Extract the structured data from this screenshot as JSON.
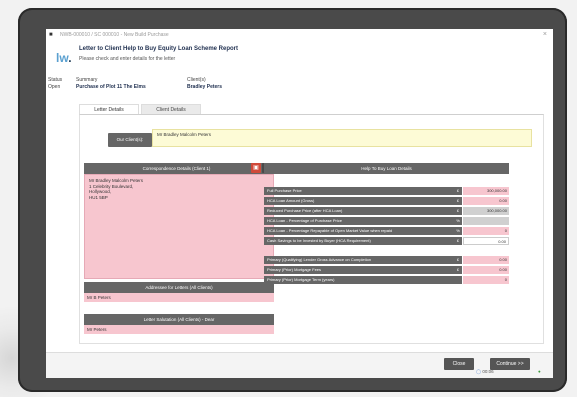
{
  "window": {
    "title": "NWB-000010 / SC 000010 - New Build Purchase",
    "header_title": "Letter to Client Help to Buy Equity Loan Scheme Report",
    "header_sub": "Please check and enter details for the letter"
  },
  "logo": {
    "text": "lw",
    "dot": "."
  },
  "summary": {
    "status_label": "Status",
    "status_value": "Open",
    "summary_label": "Summary",
    "summary_value": "Purchase of Plot 11 The Elms",
    "client_label": "Client(s)",
    "client_value": "Bradley Peters"
  },
  "tabs": [
    {
      "label": "Letter Details"
    },
    {
      "label": "Client Details"
    }
  ],
  "clients": {
    "label": "Our Client(s):",
    "value": "Mr Bradley Malcolm Peters"
  },
  "correspondence": {
    "header": "Correspondence Details (Client 1)",
    "lines": [
      "Mr Bradley Malcolm Peters",
      "1 Celebrity Boulevard,",
      "Hollywood,",
      "HU1 5BP"
    ]
  },
  "addressee": {
    "header": "Addressee for Letters (All Clients)",
    "value": "Mr B Peters"
  },
  "salutation": {
    "header": "Letter Salutation (All Clients) - Dear",
    "value": "Mr Peters"
  },
  "htb": {
    "header": "Help To Buy Loan Details",
    "rows": [
      {
        "label": "Full Purchase Price",
        "unit": "£",
        "value": "300,000.00"
      },
      {
        "label": "HCA Loan Amount (Gross)",
        "unit": "£",
        "value": "0.00"
      },
      {
        "label": "Reduced Purchase Price (after HCA Loan)",
        "unit": "£",
        "value": "300,000.00"
      },
      {
        "label": "HCA Loan - Percentage of Purchase Price",
        "unit": "%",
        "value": ""
      },
      {
        "label": "HCA Loan - Percentage Repayable of Open Market Value when repaid",
        "unit": "%",
        "value": "0"
      },
      {
        "label": "Cash Savings to be Invested by Buyer (HCA Requirement)",
        "unit": "£",
        "value": "0.00"
      },
      {
        "label": "Primary (Qualifying) Lender Gross Advance on Completion",
        "unit": "£",
        "value": "0.00"
      },
      {
        "label": "Primary (Prior) Mortgage Fees",
        "unit": "£",
        "value": "0.00"
      },
      {
        "label": "Primary (Prior) Mortgage Term (years)",
        "unit": "",
        "value": "0"
      }
    ]
  },
  "footer": {
    "close": "Close",
    "continue": "Continue >>",
    "timer": "00:06"
  },
  "colors": {
    "accent": "#666666",
    "pink_field": "#f7c6cf",
    "yellow_field": "#fdfbd6"
  }
}
